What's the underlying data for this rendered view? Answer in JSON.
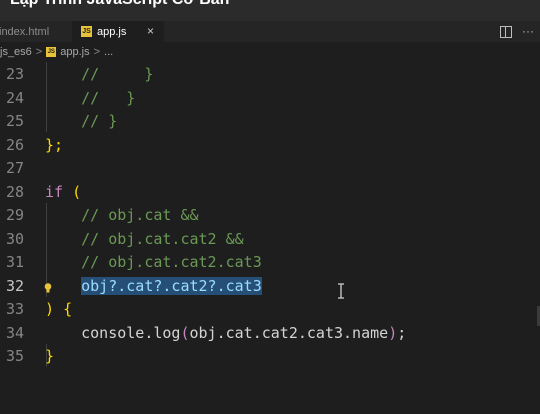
{
  "window": {
    "title": "Lập Trình JavaScript Cơ Bản"
  },
  "tabs": [
    {
      "label": "index.html",
      "active": false
    },
    {
      "label": "app.js",
      "active": true,
      "close": "×"
    }
  ],
  "breadcrumb": {
    "folder": "js_es6",
    "file": "app.js",
    "symbol": "...",
    "sep": ">"
  },
  "badge": {
    "js": "JS"
  },
  "colors": {
    "background": "#1e1e1e",
    "comment": "#6a9955",
    "keyword": "#c586c0",
    "bracket": "#ffd700",
    "selection": "#264f78"
  },
  "editor": {
    "lines": [
      {
        "n": "23",
        "parts": [
          {
            "t": "    //     }",
            "c": "comment"
          }
        ]
      },
      {
        "n": "24",
        "parts": [
          {
            "t": "    //   }",
            "c": "comment"
          }
        ]
      },
      {
        "n": "25",
        "parts": [
          {
            "t": "    // }",
            "c": "comment"
          }
        ]
      },
      {
        "n": "26",
        "parts": [
          {
            "t": "};",
            "c": "paren"
          }
        ]
      },
      {
        "n": "27",
        "parts": []
      },
      {
        "n": "28",
        "parts": [
          {
            "t": "if",
            "c": "kw"
          },
          {
            "t": " ",
            "c": "plain"
          },
          {
            "t": "(",
            "c": "paren"
          }
        ]
      },
      {
        "n": "29",
        "parts": [
          {
            "t": "    // obj.cat &&",
            "c": "comment"
          }
        ]
      },
      {
        "n": "30",
        "parts": [
          {
            "t": "    // obj.cat.cat2 &&",
            "c": "comment"
          }
        ]
      },
      {
        "n": "31",
        "parts": [
          {
            "t": "    // obj.cat.cat2.cat3",
            "c": "comment"
          }
        ]
      },
      {
        "n": "32",
        "active": true,
        "parts": [
          {
            "t": "    ",
            "c": "plain"
          },
          {
            "t": "obj?.cat?.cat2?.cat3",
            "c": "sel"
          }
        ]
      },
      {
        "n": "33",
        "parts": [
          {
            "t": ")",
            "c": "paren"
          },
          {
            "t": " ",
            "c": "plain"
          },
          {
            "t": "{",
            "c": "paren"
          }
        ]
      },
      {
        "n": "34",
        "parts": [
          {
            "t": "    console.log",
            "c": "plain"
          },
          {
            "t": "(",
            "c": "kw"
          },
          {
            "t": "obj.cat.cat2.cat3.name",
            "c": "plain"
          },
          {
            "t": ")",
            "c": "kw"
          },
          {
            "t": ";",
            "c": "plain"
          }
        ]
      },
      {
        "n": "35",
        "parts": [
          {
            "t": "}",
            "c": "paren"
          }
        ]
      }
    ]
  }
}
